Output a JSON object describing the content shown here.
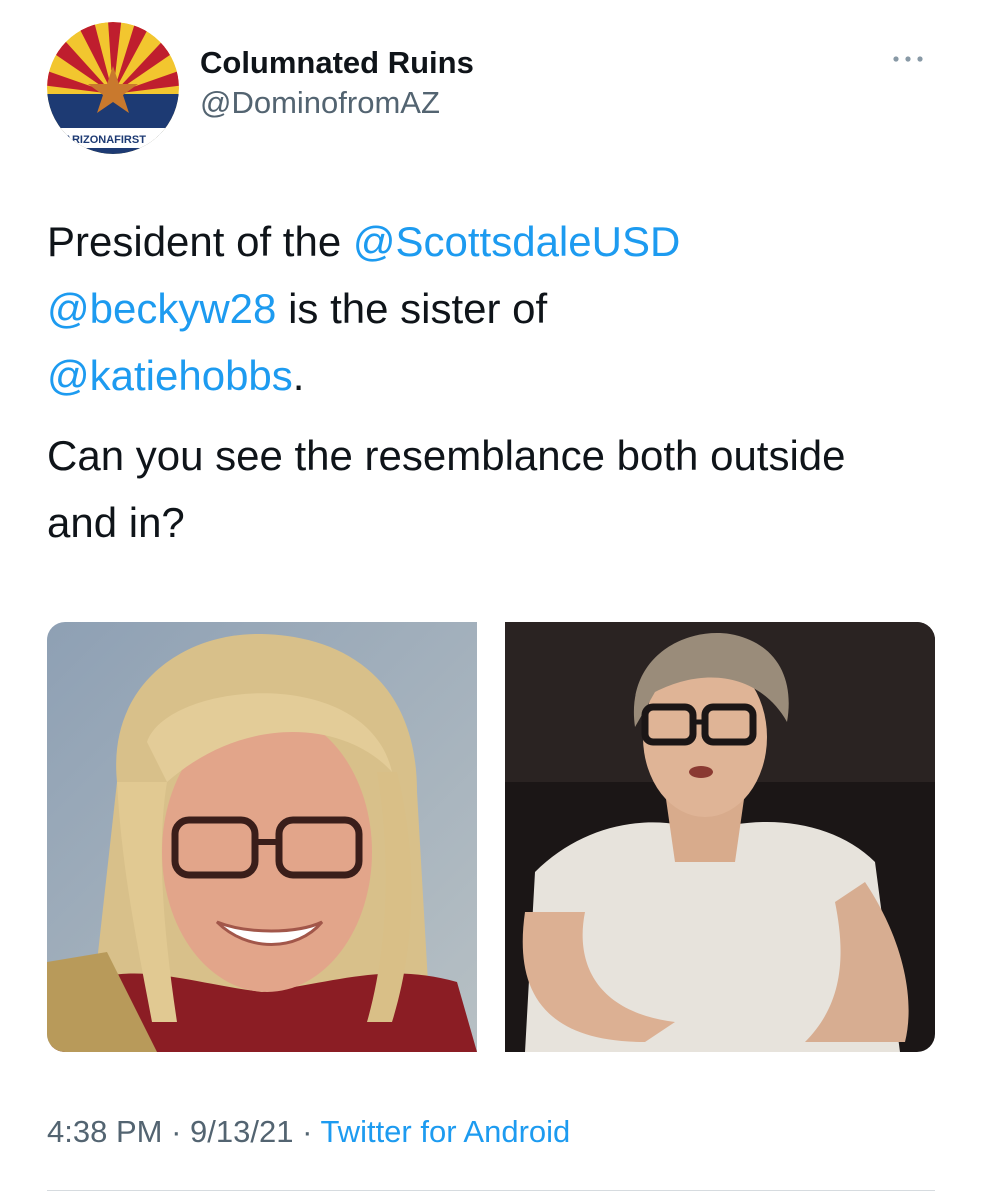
{
  "author": {
    "display_name": "Columnated Ruins",
    "handle": "@DominofromAZ",
    "avatar_label": "ARIZONAFIRST",
    "avatar_icon": "arizona-flag-icon"
  },
  "more_icon": "more-dots-icon",
  "tweet": {
    "line1_prefix": "President of the ",
    "mention_scottsdale": "@ScottsdaleUSD",
    "mention_becky": "@beckyw28",
    "line2_suffix": " is the sister of",
    "mention_katie": "@katiehobbs",
    "line3_suffix": ".",
    "paragraph2": "Can you see the resemblance both outside and in?"
  },
  "meta": {
    "time": "4:38 PM",
    "separator": " · ",
    "date": "9/13/21",
    "source": "Twitter for Android"
  },
  "colors": {
    "link": "#1d9bf0",
    "secondary_text": "#536471",
    "primary_text": "#0f1419"
  }
}
